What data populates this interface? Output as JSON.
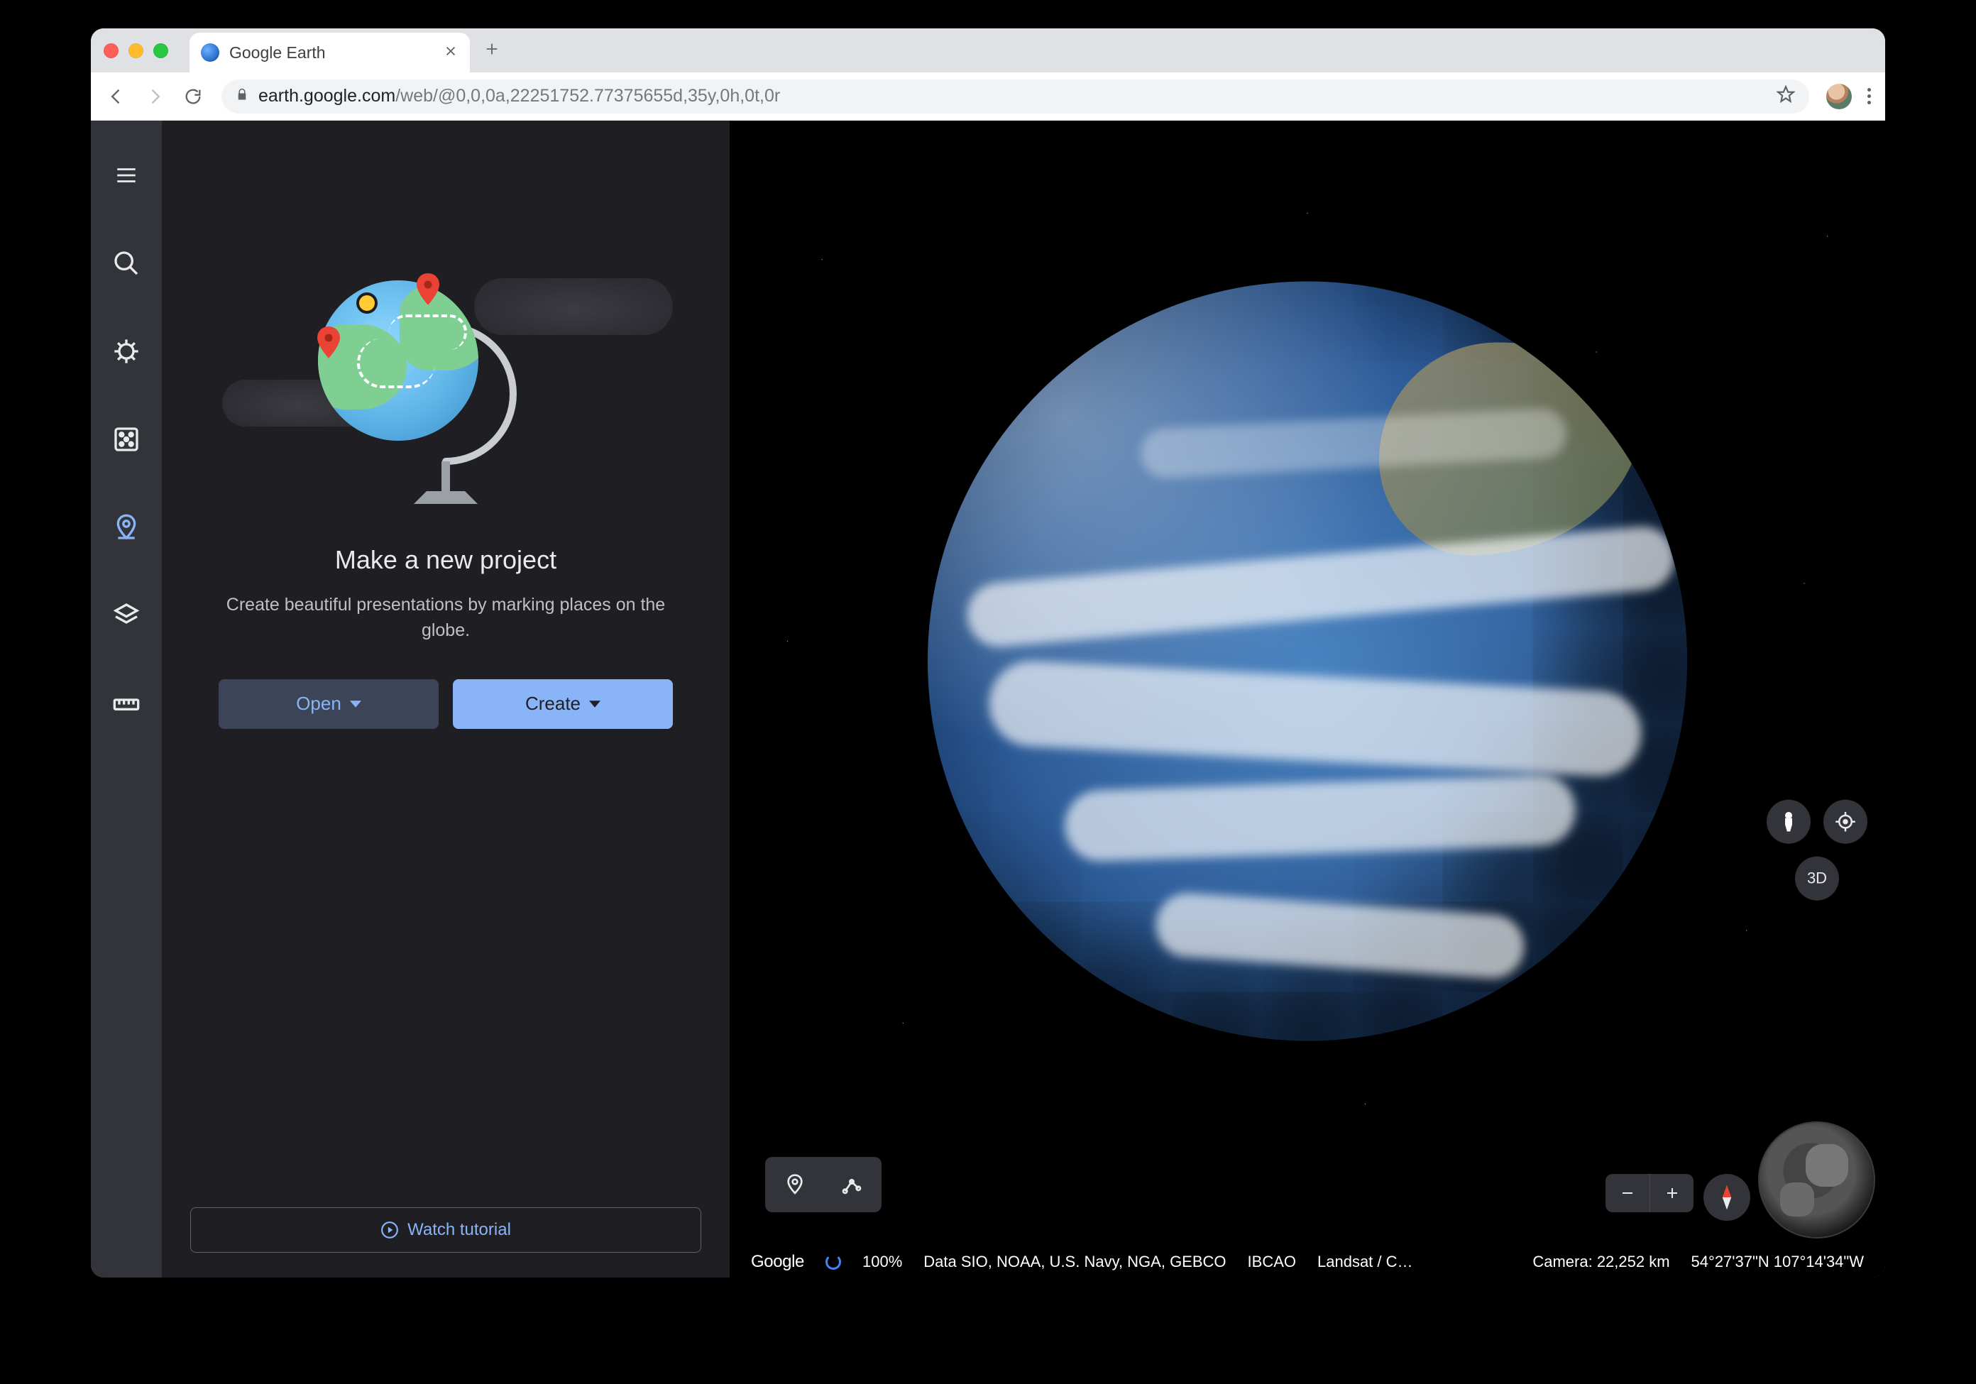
{
  "browser": {
    "tab_title": "Google Earth",
    "url_host": "earth.google.com",
    "url_path": "/web/@0,0,0a,22251752.77375655d,35y,0h,0t,0r"
  },
  "sidebar": {
    "items": [
      {
        "name": "menu",
        "label": "Menu"
      },
      {
        "name": "search",
        "label": "Search"
      },
      {
        "name": "voyager",
        "label": "Voyager"
      },
      {
        "name": "lucky",
        "label": "I'm Feeling Lucky"
      },
      {
        "name": "projects",
        "label": "Projects",
        "active": true
      },
      {
        "name": "mapstyle",
        "label": "Map style"
      },
      {
        "name": "measure",
        "label": "Measure"
      }
    ]
  },
  "panel": {
    "heading": "Make a new project",
    "description": "Create beautiful presentations by marking places on the globe.",
    "open_label": "Open",
    "create_label": "Create",
    "watch_label": "Watch tutorial"
  },
  "map_tools": {
    "placemark": "Add placemark",
    "path": "Draw line or shape",
    "pegman": "Street View",
    "locate": "My Location",
    "view3d": "3D",
    "zoom_in": "+",
    "zoom_out": "−",
    "compass": "Reset orientation",
    "overview": "Overview globe"
  },
  "status": {
    "brand": "Google",
    "progress": "100%",
    "attribution_1": "Data SIO, NOAA, U.S. Navy, NGA, GEBCO",
    "attribution_2": "IBCAO",
    "attribution_3": "Landsat / C…",
    "camera_label": "Camera:",
    "camera_value": "22,252 km",
    "coords": "54°27'37\"N 107°14'34\"W"
  }
}
